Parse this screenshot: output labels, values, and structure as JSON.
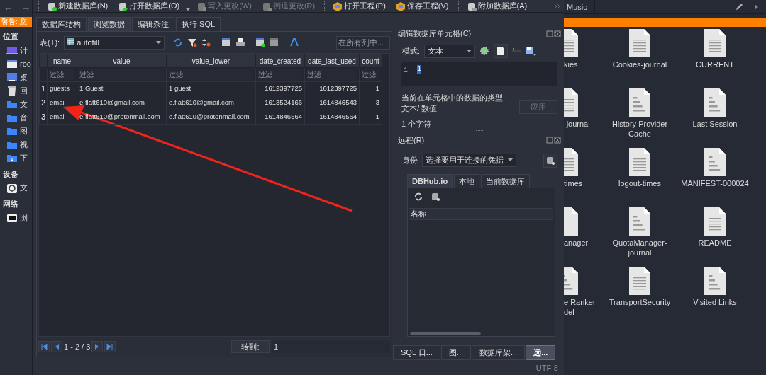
{
  "file_manager": {
    "nav_buttons": [
      "←",
      "→"
    ],
    "warning": "警告: 您",
    "sidebar": [
      {
        "heading": "位置",
        "items": [
          {
            "label": "计"
          },
          {
            "label": "roo"
          },
          {
            "label": "桌"
          },
          {
            "label": "回"
          },
          {
            "label": "文"
          },
          {
            "label": "音"
          },
          {
            "label": "图"
          },
          {
            "label": "视"
          },
          {
            "label": "下"
          }
        ]
      },
      {
        "heading": "设备",
        "items": [
          {
            "label": "文"
          }
        ]
      },
      {
        "heading": "网络",
        "items": [
          {
            "label": "浏"
          }
        ]
      }
    ],
    "path_tab": "Music",
    "partial_files": [
      {
        "name": "kies"
      },
      {
        "name": "-journal"
      },
      {
        "name": "times"
      },
      {
        "name": "anager"
      },
      {
        "name": "e Ranker\ndel"
      }
    ],
    "files": [
      {
        "name": "Cookies-journal"
      },
      {
        "name": "CURRENT"
      },
      {
        "name": "History Provider Cache"
      },
      {
        "name": "Last Session"
      },
      {
        "name": "logout-times"
      },
      {
        "name": "MANIFEST-000024"
      },
      {
        "name": "QuotaManager-journal"
      },
      {
        "name": "README"
      },
      {
        "name": "TransportSecurity"
      },
      {
        "name": "Visited Links"
      }
    ]
  },
  "db_browser": {
    "toolbar": [
      {
        "label": "新建数据库(N)",
        "disabled": false,
        "dropdown": false
      },
      {
        "label": "打开数据库(O)",
        "disabled": false,
        "dropdown": true
      },
      {
        "label": "写入更改(W)",
        "disabled": true,
        "dropdown": false
      },
      {
        "label": "倒退更改(R)",
        "disabled": true,
        "dropdown": false
      },
      {
        "label": "打开工程(P)",
        "disabled": false,
        "dropdown": false
      },
      {
        "label": "保存工程(V)",
        "disabled": false,
        "dropdown": false
      },
      {
        "label": "附加数据库(A)",
        "disabled": false,
        "dropdown": false
      }
    ],
    "main_tabs": [
      {
        "label": "数据库结构",
        "selected": false
      },
      {
        "label": "浏览数据",
        "selected": true
      },
      {
        "label": "编辑杂注",
        "selected": false
      },
      {
        "label": "执行 SQL",
        "selected": false
      }
    ],
    "browse": {
      "table_label": "表(T):",
      "table": "autofill",
      "search_placeholder": "在所有列中...",
      "columns": [
        {
          "label": "name",
          "numeric": false,
          "filter_placeholder": "过滤"
        },
        {
          "label": "value",
          "numeric": false,
          "filter_placeholder": "过滤"
        },
        {
          "label": "value_lower",
          "numeric": false,
          "filter_placeholder": "过滤"
        },
        {
          "label": "date_created",
          "numeric": true,
          "filter_placeholder": "过滤"
        },
        {
          "label": "date_last_used",
          "numeric": true,
          "filter_placeholder": "过滤"
        },
        {
          "label": "count",
          "numeric": true,
          "filter_placeholder": "过滤"
        }
      ],
      "rows": [
        {
          "number": "1",
          "cells": [
            "guests",
            "1 Guest",
            "1 guest",
            "1612397725",
            "1612397725",
            "1"
          ]
        },
        {
          "number": "2",
          "cells": [
            "email",
            "e.flatt610@gmail.com",
            "e.flatt610@gmail.com",
            "1613524166",
            "1614846543",
            "3"
          ]
        },
        {
          "number": "3",
          "cells": [
            "email",
            "e.flatt610@protonmail.com",
            "e.flatt610@protonmail.com",
            "1614846564",
            "1614846564",
            "1"
          ]
        }
      ],
      "position": "1 - 2 / 3",
      "goto_label": "转到:",
      "goto_value": "1"
    },
    "edit_cell": {
      "title": "编辑数据库单元格(C)",
      "mode_label": "模式:",
      "mode": "文本",
      "line_number": "1",
      "content": "1",
      "type_info": "当前在单元格中的数据的类型: 文本/ 数值",
      "apply": "应用",
      "apply_disabled": true,
      "char_count": "1 个字符"
    },
    "remote": {
      "title": "远程(R)",
      "identity_label": "身份",
      "identity": "选择要用于连接的凭据",
      "tabs": [
        {
          "label": "DBHub.io",
          "selected": true
        },
        {
          "label": "本地",
          "selected": false
        },
        {
          "label": "当前数据库",
          "selected": false
        }
      ],
      "column": "名称"
    },
    "dock_tabs": [
      {
        "label": "SQL 日...",
        "selected": false
      },
      {
        "label": "图...",
        "selected": false
      },
      {
        "label": "数据库架...",
        "selected": false
      },
      {
        "label": "远...",
        "selected": true
      }
    ],
    "status": "UTF-8"
  }
}
